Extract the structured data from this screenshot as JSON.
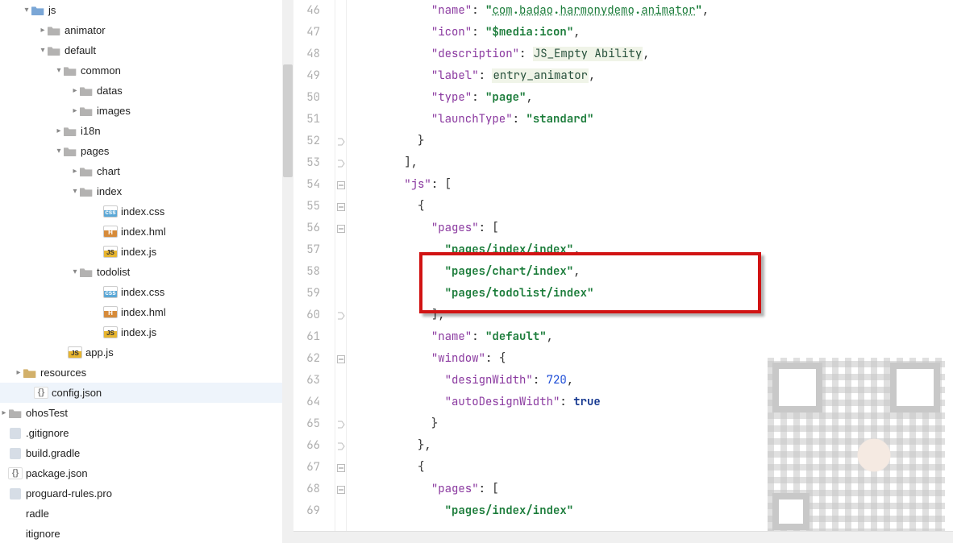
{
  "sidebar": {
    "items": [
      {
        "label": "js",
        "indent": 28,
        "chevron": "down",
        "icon": "folder-src"
      },
      {
        "label": "animator",
        "indent": 48,
        "chevron": "right",
        "icon": "folder"
      },
      {
        "label": "default",
        "indent": 48,
        "chevron": "down",
        "icon": "folder"
      },
      {
        "label": "common",
        "indent": 68,
        "chevron": "down",
        "icon": "folder"
      },
      {
        "label": "datas",
        "indent": 88,
        "chevron": "right",
        "icon": "folder"
      },
      {
        "label": "images",
        "indent": 88,
        "chevron": "right",
        "icon": "folder"
      },
      {
        "label": "i18n",
        "indent": 68,
        "chevron": "right",
        "icon": "folder"
      },
      {
        "label": "pages",
        "indent": 68,
        "chevron": "down",
        "icon": "folder"
      },
      {
        "label": "chart",
        "indent": 88,
        "chevron": "right",
        "icon": "folder"
      },
      {
        "label": "index",
        "indent": 88,
        "chevron": "down",
        "icon": "folder"
      },
      {
        "label": "index.css",
        "indent": 118,
        "chevron": "",
        "icon": "css"
      },
      {
        "label": "index.hml",
        "indent": 118,
        "chevron": "",
        "icon": "hml"
      },
      {
        "label": "index.js",
        "indent": 118,
        "chevron": "",
        "icon": "js"
      },
      {
        "label": "todolist",
        "indent": 88,
        "chevron": "down",
        "icon": "folder"
      },
      {
        "label": "index.css",
        "indent": 118,
        "chevron": "",
        "icon": "css"
      },
      {
        "label": "index.hml",
        "indent": 118,
        "chevron": "",
        "icon": "hml"
      },
      {
        "label": "index.js",
        "indent": 118,
        "chevron": "",
        "icon": "js"
      },
      {
        "label": "app.js",
        "indent": 74,
        "chevron": "",
        "icon": "js"
      },
      {
        "label": "resources",
        "indent": 18,
        "chevron": "right",
        "icon": "folder-res"
      },
      {
        "label": "config.json",
        "indent": 32,
        "chevron": "",
        "icon": "json",
        "selected": true
      },
      {
        "label": "ohosTest",
        "indent": 0,
        "chevron": "right",
        "icon": "folder"
      },
      {
        "label": ".gitignore",
        "indent": 0,
        "chevron": "",
        "icon": "file"
      },
      {
        "label": "build.gradle",
        "indent": 0,
        "chevron": "",
        "icon": "gradle"
      },
      {
        "label": "package.json",
        "indent": 0,
        "chevron": "",
        "icon": "json"
      },
      {
        "label": "proguard-rules.pro",
        "indent": 0,
        "chevron": "",
        "icon": "file"
      },
      {
        "label": "radle",
        "indent": -12,
        "chevron": "",
        "icon": ""
      },
      {
        "label": "itignore",
        "indent": -12,
        "chevron": "",
        "icon": ""
      }
    ]
  },
  "editor": {
    "first_line_number": 46,
    "lines": [
      {
        "n": 46,
        "indent": 12,
        "tokens": [
          {
            "t": "\"name\"",
            "c": "key"
          },
          {
            "t": ": ",
            "c": "punc"
          },
          {
            "t": "\"",
            "c": "str"
          },
          {
            "t": "com",
            "c": "url"
          },
          {
            "t": ".",
            "c": "str"
          },
          {
            "t": "badao",
            "c": "url"
          },
          {
            "t": ".",
            "c": "str"
          },
          {
            "t": "harmonydemo",
            "c": "url"
          },
          {
            "t": ".",
            "c": "str"
          },
          {
            "t": "animator",
            "c": "url"
          },
          {
            "t": "\"",
            "c": "str"
          },
          {
            "t": ",",
            "c": "punc"
          }
        ]
      },
      {
        "n": 47,
        "indent": 12,
        "tokens": [
          {
            "t": "\"icon\"",
            "c": "key"
          },
          {
            "t": ": ",
            "c": "punc"
          },
          {
            "t": "\"$media:icon\"",
            "c": "str"
          },
          {
            "t": ",",
            "c": "punc"
          }
        ]
      },
      {
        "n": 48,
        "indent": 12,
        "tokens": [
          {
            "t": "\"description\"",
            "c": "key"
          },
          {
            "t": ": ",
            "c": "punc"
          },
          {
            "t": "JS_Empty Ability",
            "c": "ident"
          },
          {
            "t": ",",
            "c": "punc"
          }
        ]
      },
      {
        "n": 49,
        "indent": 12,
        "tokens": [
          {
            "t": "\"label\"",
            "c": "key"
          },
          {
            "t": ": ",
            "c": "punc"
          },
          {
            "t": "entry_animator",
            "c": "ident"
          },
          {
            "t": ",",
            "c": "punc"
          }
        ]
      },
      {
        "n": 50,
        "indent": 12,
        "tokens": [
          {
            "t": "\"type\"",
            "c": "key"
          },
          {
            "t": ": ",
            "c": "punc"
          },
          {
            "t": "\"page\"",
            "c": "str"
          },
          {
            "t": ",",
            "c": "punc"
          }
        ]
      },
      {
        "n": 51,
        "indent": 12,
        "tokens": [
          {
            "t": "\"launchType\"",
            "c": "key"
          },
          {
            "t": ": ",
            "c": "punc"
          },
          {
            "t": "\"standard\"",
            "c": "str"
          }
        ]
      },
      {
        "n": 52,
        "indent": 10,
        "fold": "close",
        "tokens": [
          {
            "t": "}",
            "c": "punc"
          }
        ]
      },
      {
        "n": 53,
        "indent": 8,
        "fold": "close",
        "tokens": [
          {
            "t": "],",
            "c": "punc"
          }
        ]
      },
      {
        "n": 54,
        "indent": 8,
        "fold": "open",
        "tokens": [
          {
            "t": "\"js\"",
            "c": "key"
          },
          {
            "t": ": [",
            "c": "punc"
          }
        ]
      },
      {
        "n": 55,
        "indent": 10,
        "fold": "open",
        "tokens": [
          {
            "t": "{",
            "c": "punc"
          }
        ]
      },
      {
        "n": 56,
        "indent": 12,
        "fold": "open",
        "tokens": [
          {
            "t": "\"pages\"",
            "c": "key"
          },
          {
            "t": ": [",
            "c": "punc"
          }
        ]
      },
      {
        "n": 57,
        "indent": 14,
        "tokens": [
          {
            "t": "\"pages/index/index\"",
            "c": "str"
          },
          {
            "t": ",",
            "c": "punc"
          }
        ]
      },
      {
        "n": 58,
        "indent": 14,
        "tokens": [
          {
            "t": "\"pages/chart/index\"",
            "c": "str"
          },
          {
            "t": ",",
            "c": "punc"
          }
        ]
      },
      {
        "n": 59,
        "indent": 14,
        "tokens": [
          {
            "t": "\"pages/todolist/index\"",
            "c": "str"
          }
        ]
      },
      {
        "n": 60,
        "indent": 12,
        "fold": "close",
        "tokens": [
          {
            "t": "],",
            "c": "punc"
          }
        ]
      },
      {
        "n": 61,
        "indent": 12,
        "tokens": [
          {
            "t": "\"name\"",
            "c": "key"
          },
          {
            "t": ": ",
            "c": "punc"
          },
          {
            "t": "\"default\"",
            "c": "str"
          },
          {
            "t": ",",
            "c": "punc"
          }
        ]
      },
      {
        "n": 62,
        "indent": 12,
        "fold": "open",
        "tokens": [
          {
            "t": "\"window\"",
            "c": "key"
          },
          {
            "t": ": {",
            "c": "punc"
          }
        ]
      },
      {
        "n": 63,
        "indent": 14,
        "tokens": [
          {
            "t": "\"designWidth\"",
            "c": "key"
          },
          {
            "t": ": ",
            "c": "punc"
          },
          {
            "t": "720",
            "c": "num"
          },
          {
            "t": ",",
            "c": "punc"
          }
        ]
      },
      {
        "n": 64,
        "indent": 14,
        "tokens": [
          {
            "t": "\"autoDesignWidth\"",
            "c": "key"
          },
          {
            "t": ": ",
            "c": "punc"
          },
          {
            "t": "true",
            "c": "bool"
          }
        ]
      },
      {
        "n": 65,
        "indent": 12,
        "fold": "close",
        "tokens": [
          {
            "t": "}",
            "c": "punc"
          }
        ]
      },
      {
        "n": 66,
        "indent": 10,
        "fold": "close",
        "tokens": [
          {
            "t": "},",
            "c": "punc"
          }
        ]
      },
      {
        "n": 67,
        "indent": 10,
        "fold": "open",
        "tokens": [
          {
            "t": "{",
            "c": "punc"
          }
        ]
      },
      {
        "n": 68,
        "indent": 12,
        "fold": "open",
        "tokens": [
          {
            "t": "\"pages\"",
            "c": "key"
          },
          {
            "t": ": [",
            "c": "punc"
          }
        ]
      },
      {
        "n": 69,
        "indent": 14,
        "tokens": [
          {
            "t": "\"pages/index/index\"",
            "c": "str"
          }
        ]
      }
    ]
  }
}
